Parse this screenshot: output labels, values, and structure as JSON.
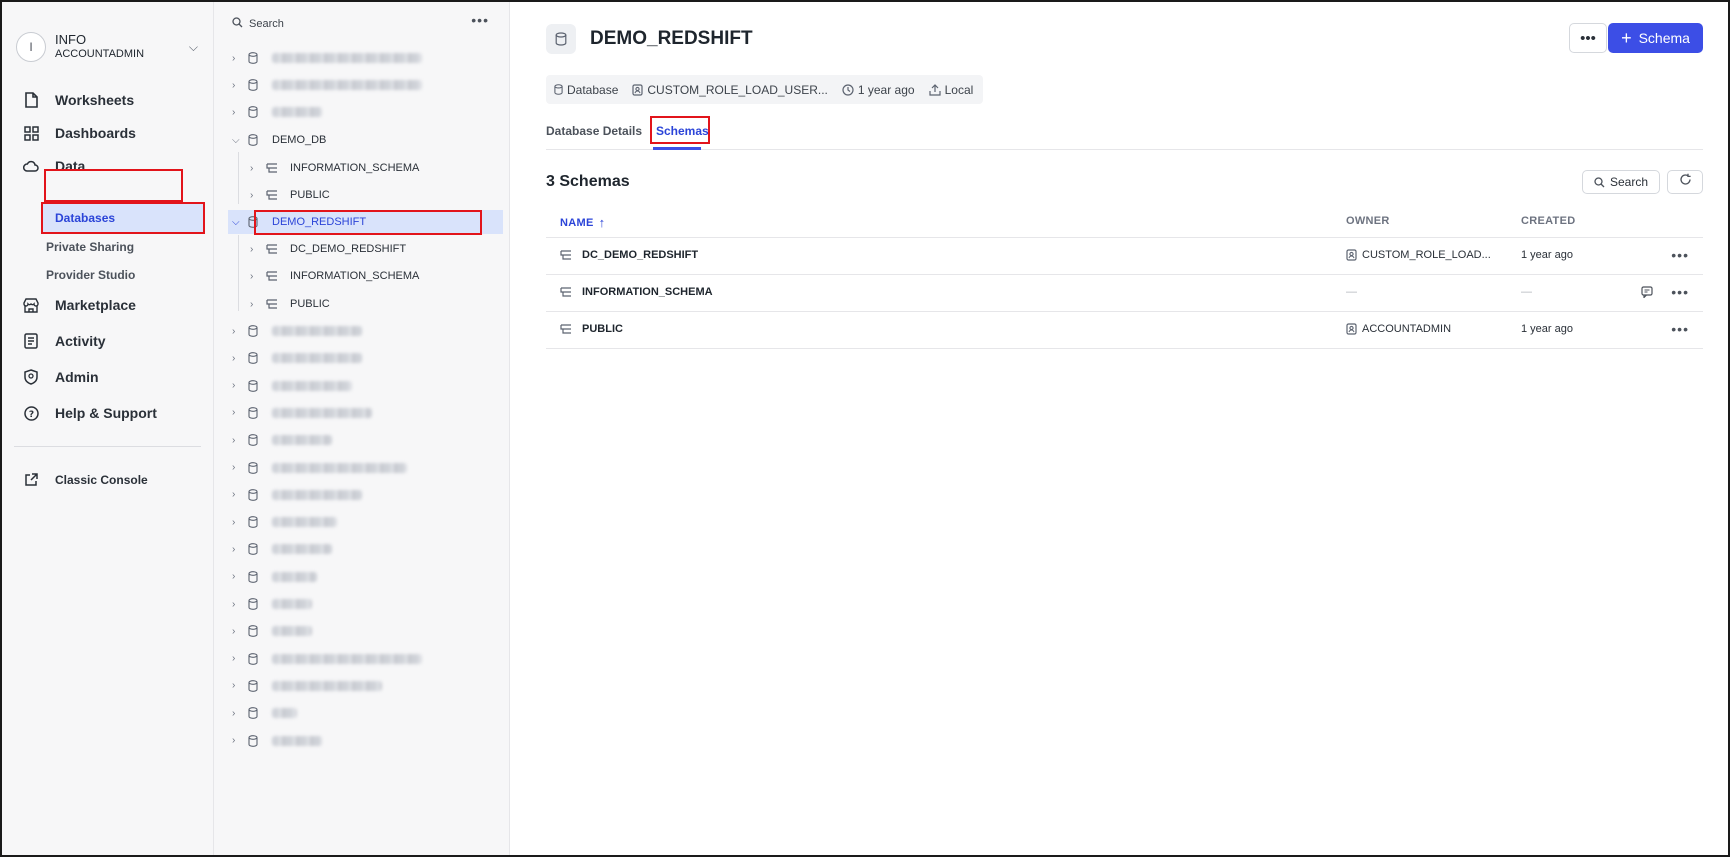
{
  "account": {
    "initial": "I",
    "name": "INFO",
    "role": "ACCOUNTADMIN"
  },
  "nav": {
    "worksheets": "Worksheets",
    "dashboards": "Dashboards",
    "data": "Data",
    "databases": "Databases",
    "private_sharing": "Private Sharing",
    "provider_studio": "Provider Studio",
    "marketplace": "Marketplace",
    "activity": "Activity",
    "admin": "Admin",
    "help": "Help & Support",
    "classic_console": "Classic Console"
  },
  "tree": {
    "search_label": "Search",
    "demo_db": "DEMO_DB",
    "demo_db_children": [
      "INFORMATION_SCHEMA",
      "PUBLIC"
    ],
    "demo_redshift": "DEMO_REDSHIFT",
    "demo_redshift_children": [
      "DC_DEMO_REDSHIFT",
      "INFORMATION_SCHEMA",
      "PUBLIC"
    ]
  },
  "header": {
    "title": "DEMO_REDSHIFT",
    "primary_button": "Schema",
    "meta_type": "Database",
    "meta_owner": "CUSTOM_ROLE_LOAD_USER...",
    "meta_time": "1 year ago",
    "meta_source": "Local"
  },
  "tabs": {
    "details": "Database Details",
    "schemas": "Schemas"
  },
  "section": {
    "title": "3 Schemas",
    "search": "Search"
  },
  "table": {
    "col_name": "NAME",
    "col_owner": "OWNER",
    "col_created": "CREATED",
    "rows": [
      {
        "name": "DC_DEMO_REDSHIFT",
        "owner": "CUSTOM_ROLE_LOAD...",
        "created": "1 year ago"
      },
      {
        "name": "INFORMATION_SCHEMA",
        "owner": "—",
        "created": "—"
      },
      {
        "name": "PUBLIC",
        "owner": "ACCOUNTADMIN",
        "created": "1 year ago"
      }
    ]
  },
  "colors": {
    "accent": "#3c4ee6",
    "highlight": "#e2141b",
    "selected_bg": "#d9e3fb"
  }
}
